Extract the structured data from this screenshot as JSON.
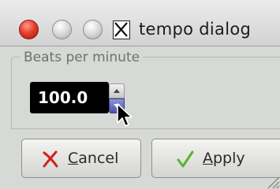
{
  "window": {
    "title": "tempo dialog",
    "controls": [
      "close",
      "minimize",
      "maximize"
    ]
  },
  "frame": {
    "label": "Beats per minute"
  },
  "tempo": {
    "value": "100.0"
  },
  "buttons": {
    "cancel": {
      "mnemonic": "C",
      "rest": "ancel",
      "icon": "cancel-x-icon"
    },
    "apply": {
      "mnemonic": "A",
      "rest": "pply",
      "icon": "checkmark-icon"
    }
  },
  "colors": {
    "close_button": "#e5402e",
    "spin_down_active": "#4a53b0",
    "entry_bg": "#000000",
    "cancel_icon": "#d41e1e",
    "apply_icon": "#55b52f"
  }
}
